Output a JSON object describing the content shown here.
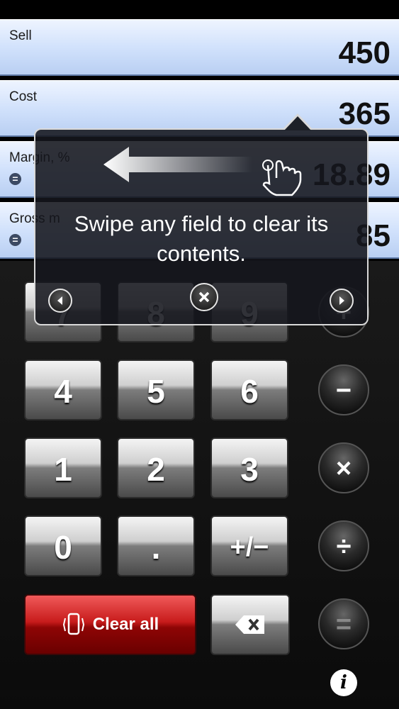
{
  "fields": {
    "sell": {
      "label": "Sell",
      "value": "450"
    },
    "cost": {
      "label": "Cost",
      "value": "365"
    },
    "margin": {
      "label": "Margin, %",
      "value": "18.89"
    },
    "gross": {
      "label": "Gross m",
      "value": "85"
    }
  },
  "keypad": {
    "row1": [
      "7",
      "8",
      "9"
    ],
    "row2": [
      "4",
      "5",
      "6"
    ],
    "row3": [
      "1",
      "2",
      "3"
    ],
    "row4": [
      "0",
      ".",
      "+/−"
    ],
    "ops": [
      "+",
      "−",
      "×",
      "÷",
      "="
    ],
    "clear_all": "Clear all",
    "info": "i"
  },
  "tooltip": {
    "text": "Swipe any field to clear its contents."
  },
  "colors": {
    "field_bg": "#cfe0fb",
    "clear_red": "#c81c1c"
  }
}
